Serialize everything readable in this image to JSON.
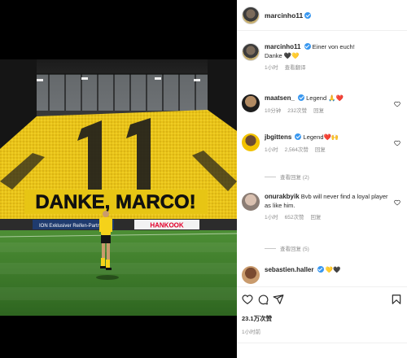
{
  "post": {
    "username": "marcinho11",
    "caption_line1": "Einer von euch!",
    "caption_line2": "Danke 🖤💛",
    "caption_time": "1小时",
    "caption_translate": "查看翻译",
    "photo": {
      "banner_text": "DANKE, MARCO!",
      "tifo_number": "11",
      "board_left": "ION  Exklusiver Reifen-Partner",
      "board_right": "HANKOOK"
    }
  },
  "comments": [
    {
      "username": "maatsen_",
      "text": "Legend 🙏❤️",
      "time": "10分钟",
      "likes": "232次赞",
      "reply": "回复"
    },
    {
      "username": "jbgittens",
      "text": "Legend❤️🙌",
      "time": "1小时",
      "likes": "2,564次赞",
      "reply": "回复",
      "view_replies": "查看回复 (2)"
    },
    {
      "username": "onurakbyik",
      "text": "Bvb will never find a loyal player as like him.",
      "time": "1小时",
      "likes": "652次赞",
      "reply": "回复",
      "view_replies": "查看回复 (5)"
    },
    {
      "username": "sebastien.haller",
      "text": "💛🖤"
    }
  ],
  "footer": {
    "likes_count": "23.1万次赞",
    "post_time": "1小时前"
  },
  "colors": {
    "verified": "#3897f0",
    "bvb_yellow": "#f5d21a",
    "grass": "#3f7d2c",
    "like_red": "#ed4956"
  },
  "icons": [
    "verified-badge-icon",
    "heart-icon",
    "comment-icon",
    "share-icon",
    "bookmark-icon"
  ]
}
